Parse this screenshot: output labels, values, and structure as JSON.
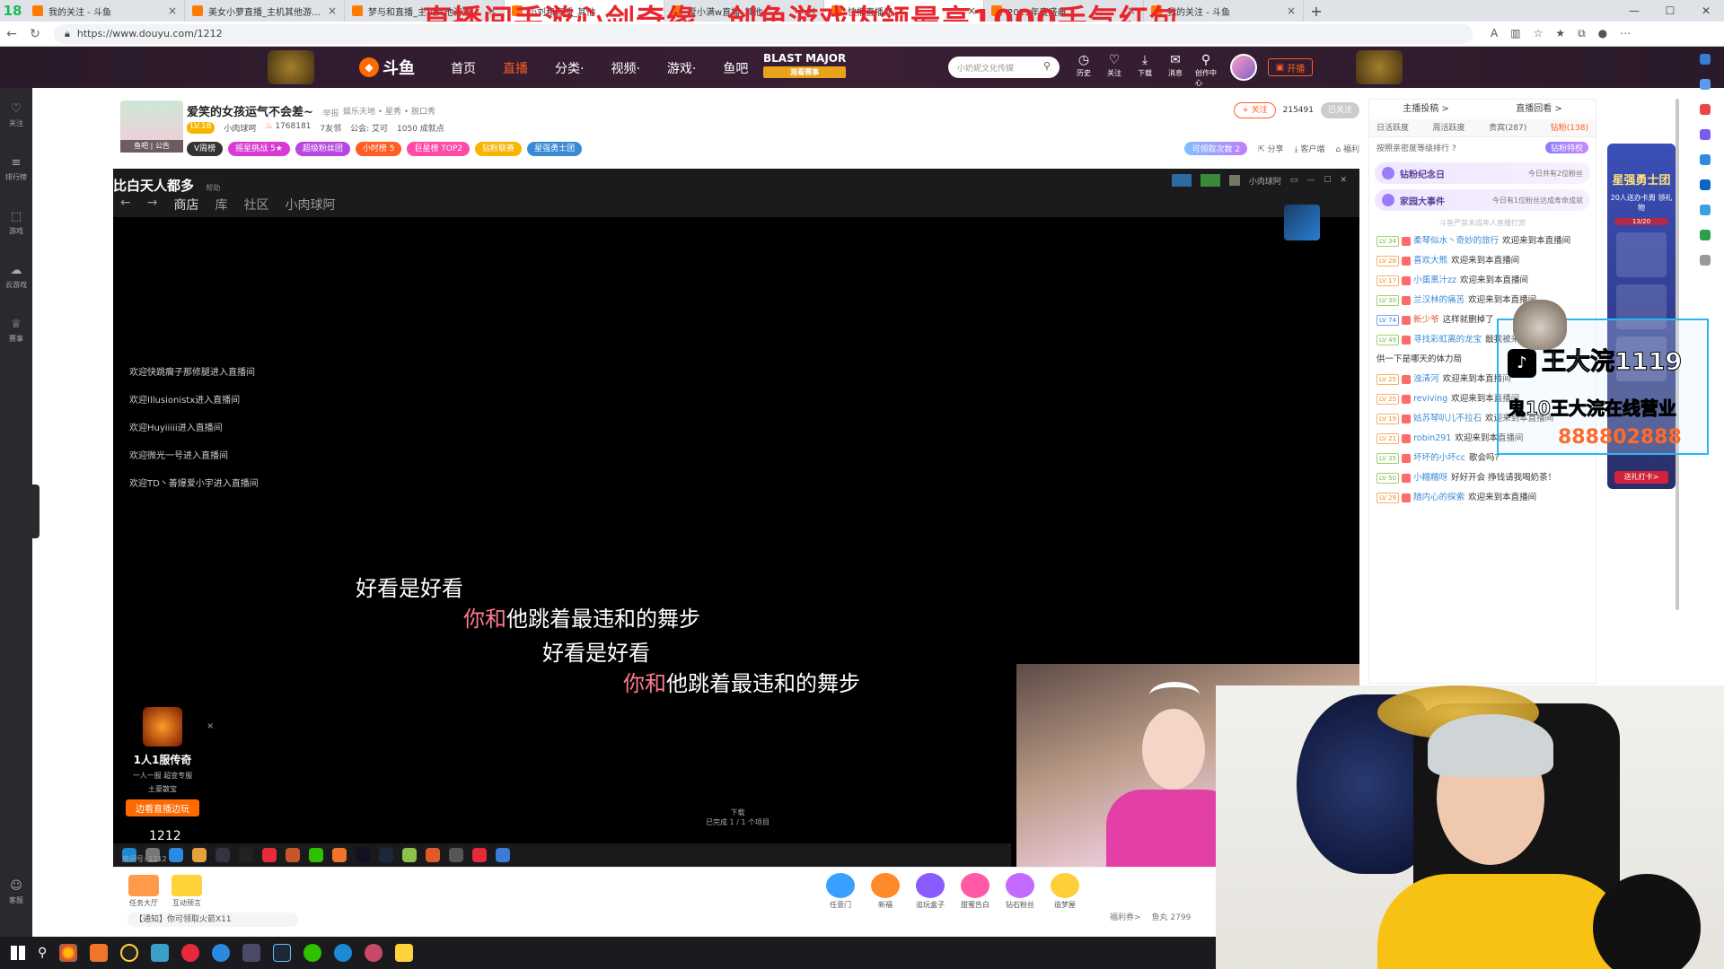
{
  "browser": {
    "tabs": [
      {
        "label": "我的关注 - 斗鱼",
        "color": "#ff7a00"
      },
      {
        "label": "美女小萝直播_主机其他游戏直播",
        "color": "#ff7a00"
      },
      {
        "label": "梦与和直播_主机其他游戏直播",
        "color": "#ff7a00"
      },
      {
        "label": "小刘和直播_其他",
        "color": "#ff7a00"
      },
      {
        "label": "爱小满w直播_其他",
        "color": "#ff7a00"
      },
      {
        "label": "快播直播间",
        "color": "#ff7a00"
      },
      {
        "label": "2023年度盛典",
        "color": "#ff7a00"
      },
      {
        "label": "我的关注 - 斗鱼",
        "color": "#ff7a00"
      }
    ],
    "url": "https://www.douyu.com/1212",
    "new_tab": "+"
  },
  "banner": "直播间手游心剑奇缘，创角游戏内领最高1000手气红包",
  "site": {
    "brand": "斗鱼",
    "nav": [
      "首页",
      "直播",
      "分类·",
      "视频·",
      "游戏·",
      "鱼吧"
    ],
    "active_nav": "直播",
    "major_title": "BLAST MAJOR",
    "major_sub": "观看赛事",
    "search_placeholder": "小奶妮文化传媒",
    "header_icons": [
      {
        "glyph": "◷",
        "label": "历史"
      },
      {
        "glyph": "♡",
        "label": "关注"
      },
      {
        "glyph": "⤓",
        "label": "下载"
      },
      {
        "glyph": "✉",
        "label": "消息"
      },
      {
        "glyph": "⚲",
        "label": "创作中心"
      }
    ],
    "golive": "开播"
  },
  "left_rail": [
    {
      "glyph": "♡",
      "label": "关注"
    },
    {
      "glyph": "≡",
      "label": "排行榜"
    },
    {
      "glyph": "⬚",
      "label": "游戏"
    },
    {
      "glyph": "☁",
      "label": "云游戏"
    },
    {
      "glyph": "♕",
      "label": "赛事"
    }
  ],
  "left_rail_bottom": {
    "glyph": "☺",
    "label": "客服"
  },
  "room": {
    "avatar_caption": "鱼吧 | 公告",
    "title": "爱笑的女孩运气不会差~",
    "report": "举报",
    "category": "娱乐天地 • 星秀 • 脱口秀",
    "level": "LV.18",
    "anchor": "小肉球呵",
    "hot": "1768181",
    "friends": "7友邻",
    "guild": "公会: 艾可",
    "achievements": "1050 成就点",
    "badges": [
      {
        "label": "V周榜",
        "color": "#333"
      },
      {
        "label": "摇星挑战 5★",
        "color": "#d93ad3"
      },
      {
        "label": "超级粉丝团",
        "color": "#b846e0"
      },
      {
        "label": "小时榜 5",
        "color": "#ff5d23"
      },
      {
        "label": "巨星榜 TOP2",
        "color": "#ff4aa8"
      },
      {
        "label": "钻粉联赛",
        "color": "#f7b500"
      },
      {
        "label": "星强勇士团",
        "color": "#3a8ad5"
      }
    ],
    "follow": "+ 关注",
    "follower_count": "215491",
    "followed": "已关注",
    "gift_pill": "可领取次数 2",
    "share": "分享",
    "client": "客户端",
    "welfare": "福利"
  },
  "stream": {
    "title": "比白天人都多",
    "title_suffix": "帮助",
    "tabs": [
      "←",
      "→",
      "商店",
      "库",
      "社区",
      "小肉球阿"
    ],
    "user_label": "小肉球阿",
    "welcomes": [
      "欢迎快跳瘸子那修腿进入直播间",
      "欢迎Illusionistx进入直播间",
      "欢迎Huyiiiii进入直播间",
      "欢迎微光一号进入直播间",
      "欢迎TD丶善爆爱小宇进入直播间"
    ],
    "lyrics": [
      {
        "text": "好看是好看",
        "red": ""
      },
      {
        "text": "他跳着最违和的舞步",
        "red": "你和"
      },
      {
        "text": "好看是好看",
        "red": ""
      },
      {
        "text": "他跳着最违和的舞步",
        "red": "你和"
      }
    ],
    "ad": {
      "title": "1人1服传奇",
      "sub1": "一人一服",
      "sub2": "超变专服",
      "sub3": "土豪散宝",
      "button": "边看直播边玩"
    },
    "ad_close": "×",
    "room_number": "1212",
    "room_label": "房间号: 1212",
    "download_center": "下载",
    "download_sub": "已完成 1 / 1 个项目"
  },
  "underbar": {
    "left_items": [
      {
        "label": "任务大厅",
        "color": "#ff9a4a"
      },
      {
        "label": "互动预言",
        "color": "#ffd23a"
      }
    ],
    "notice": "【通知】你可领取火箭X11",
    "gifts": [
      {
        "label": "任意门",
        "color": "#3aa0ff"
      },
      {
        "label": "新福",
        "color": "#ff8a2a"
      },
      {
        "label": "追玩盒子",
        "color": "#8a5cff"
      },
      {
        "label": "甜蜜告白",
        "color": "#ff5aa8"
      },
      {
        "label": "钻石粉丝",
        "color": "#c46bff"
      },
      {
        "label": "造梦屋",
        "color": "#ffcf3a"
      }
    ],
    "welfare_link": "福利券>",
    "fishball": "鱼丸 2799"
  },
  "chat": {
    "top_tabs": [
      "主播投稿 >",
      "直播回看 >"
    ],
    "rank_tabs": [
      "日活跃度",
      "周活跃度",
      "贵宾(287)",
      "钻粉(138)"
    ],
    "rank_active": "钻粉(138)",
    "rank_note": "按照亲密度等级排行 ?",
    "vip_label": "钻粉特权",
    "cards": [
      {
        "title": "钻粉纪念日",
        "right": "今日共有2位粉丝"
      },
      {
        "title": "家园大事件",
        "right": "今日有1位粉丝达成寿命成就"
      }
    ],
    "note": "斗鱼严禁未成年人直播打赏",
    "messages": [
      {
        "lv": "LV 34",
        "lvc": "",
        "name": "柔琴似水丶奇妙的旅行",
        "text": "欢迎来到本直播间"
      },
      {
        "lv": "LV 28",
        "lvc": "or",
        "name": "喜欢大熊",
        "text": "欢迎来到本直播间"
      },
      {
        "lv": "LV 17",
        "lvc": "or",
        "name": "小蛋黑汁zz",
        "text": "欢迎来到本直播间"
      },
      {
        "lv": "LV 30",
        "lvc": "",
        "name": "兰汉林的痛苦",
        "text": "欢迎来到本直播间"
      },
      {
        "lv": "LV 74",
        "lvc": "bl",
        "name": "新少爷",
        "text": "这样就删掉了"
      },
      {
        "lv": "LV 49",
        "lvc": "",
        "name": "寻找彩虹离的龙宝",
        "text": "敲我被来被打"
      },
      {
        "lv": "",
        "lvc": "",
        "name": "",
        "text": "供一下是哪天的体力局"
      },
      {
        "lv": "LV 25",
        "lvc": "or",
        "name": "浊清河",
        "text": "欢迎来到本直播间"
      },
      {
        "lv": "LV 25",
        "lvc": "or",
        "name": "reviving",
        "text": "欢迎来到本直播间"
      },
      {
        "lv": "LV 19",
        "lvc": "or",
        "name": "姑苏琴叭儿不拉石",
        "text": "欢迎来到本直播间"
      },
      {
        "lv": "LV 21",
        "lvc": "or",
        "name": "robin291",
        "text": "欢迎来到本直播间"
      },
      {
        "lv": "LV 35",
        "lvc": "",
        "name": "坏坏的小坏cc",
        "text": "歌会吗?"
      },
      {
        "lv": "LV 50",
        "lvc": "",
        "name": "小糯糯呀",
        "text": "好好开会 挣钱请我喝奶茶！"
      },
      {
        "lv": "LV 29",
        "lvc": "or",
        "name": "随内心的探索",
        "text": "欢迎来到本直播间"
      }
    ]
  },
  "activity": {
    "title": "星强勇士团",
    "sub": "20人送办卡周 领礼物",
    "progress": "13/20",
    "button": "送礼打卡>"
  },
  "overlay": {
    "tiktok_glyph": "♪",
    "name": "王大浣1119",
    "sub": "鬼10王大浣在线营业",
    "number": "888802888"
  }
}
